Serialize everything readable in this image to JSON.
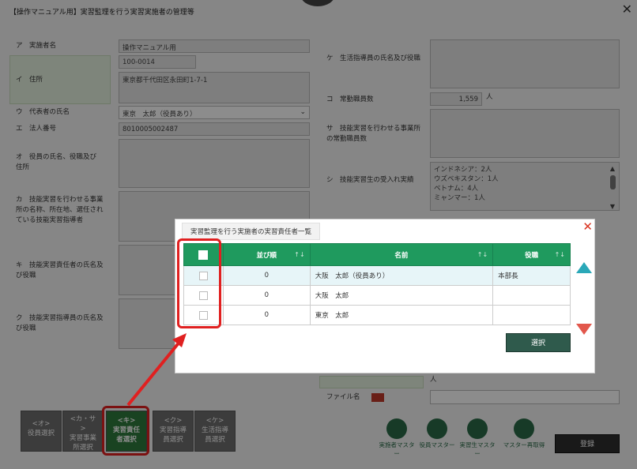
{
  "window": {
    "title": "【操作マニュアル用】実習監理を行う実習実施者の管理等"
  },
  "form": {
    "a": {
      "label": "ア　実施者名",
      "value": "操作マニュアル用"
    },
    "i": {
      "label": "イ　住所",
      "zip": "100-0014",
      "address": "東京都千代田区永田町1-7-1"
    },
    "u": {
      "label": "ウ　代表者の氏名",
      "value": "東京　太郎（役員あり）"
    },
    "e": {
      "label": "エ　法人番号",
      "value": "8010005002487"
    },
    "o": {
      "label": "オ　役員の氏名、役職及び住所"
    },
    "ka": {
      "label": "カ　技能実習を行わせる事業所の名称、所在地、選任されている技能実習指導者"
    },
    "ki": {
      "label": "キ　技能実習責任者の氏名及び役職"
    },
    "ku": {
      "label": "ク　技能実習指導員の氏名及び役職"
    },
    "ke": {
      "label": "ケ　生活指導員の氏名及び役職"
    },
    "ko": {
      "label": "コ　常勤職員数",
      "value": "1,559",
      "unit": "人"
    },
    "sa": {
      "label": "サ　技能実習を行わせる事業所の常勤職員数"
    },
    "shi": {
      "label": "シ　技能実習生の受入れ実績",
      "lines": [
        "インドネシア：2人",
        "ウズベキスタン：1人",
        "ベトナム：4人",
        "ミャンマー：1人"
      ]
    },
    "file_label": "ファイル名",
    "unit_person": "人"
  },
  "tabs": [
    {
      "label": "<オ>\n役員選択"
    },
    {
      "label": "<カ・サ\n>\n実習事業\n所選択"
    },
    {
      "label": "<キ>\n実習責任\n者選択"
    },
    {
      "label": "<ク>\n実習指導\n員選択"
    },
    {
      "label": "<ケ>\n生活指導\n員選択"
    }
  ],
  "masters": [
    "実施者マスター",
    "役員マスター",
    "実習生マスター",
    "マスター再取得"
  ],
  "register_label": "登録",
  "modal": {
    "title": "実習監理を行う実施者の実習責任者一覧",
    "headers": {
      "order": "並び順",
      "name": "名前",
      "role": "役職",
      "sort_icon": "↑↓"
    },
    "rows": [
      {
        "order": "0",
        "name": "大阪　太郎（役員あり）",
        "role": "本部長"
      },
      {
        "order": "0",
        "name": "大阪　太郎",
        "role": ""
      },
      {
        "order": "0",
        "name": "東京　太郎",
        "role": ""
      }
    ],
    "select_label": "選択",
    "close_icon": "✕"
  },
  "colors": {
    "header_green": "#1f9a5e",
    "highlight_red": "#e02020",
    "active_tab": "#2f7a3c"
  }
}
